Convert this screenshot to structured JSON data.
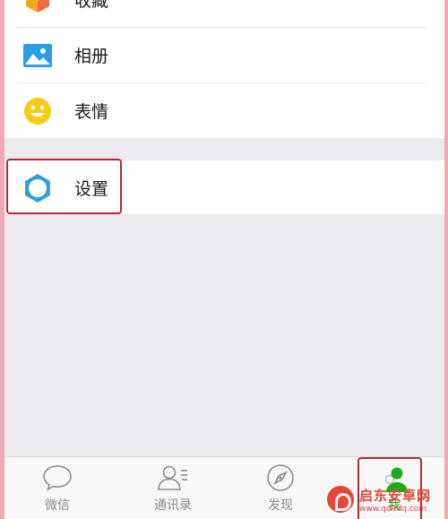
{
  "menu": {
    "favorites_label": "收藏",
    "album_label": "相册",
    "stickers_label": "表情",
    "settings_label": "设置"
  },
  "tabbar": {
    "tabs": [
      {
        "label": "微信"
      },
      {
        "label": "通讯录"
      },
      {
        "label": "发现"
      },
      {
        "label": "我"
      }
    ]
  },
  "watermark": {
    "title": "启东安卓网",
    "url": "www.qdltdq.com"
  },
  "colors": {
    "frame_pink": "#f1a9b3",
    "highlight_red": "#b52a35",
    "settings_icon_blue": "#2f9de0",
    "album_icon_blue": "#2a9ee3",
    "sticker_icon_yellow": "#f7cb1b",
    "favorites_icon_orange": "#f5a623",
    "wechat_green": "#1aad19",
    "tab_gray": "#8c8c90"
  },
  "icons": {
    "favorites": "favorites-cube-icon",
    "album": "picture-icon",
    "stickers": "smiley-icon",
    "settings": "gear-icon",
    "tab_chats": "chat-bubble-icon",
    "tab_contacts": "contacts-icon",
    "tab_discover": "compass-icon",
    "tab_me": "person-icon"
  }
}
